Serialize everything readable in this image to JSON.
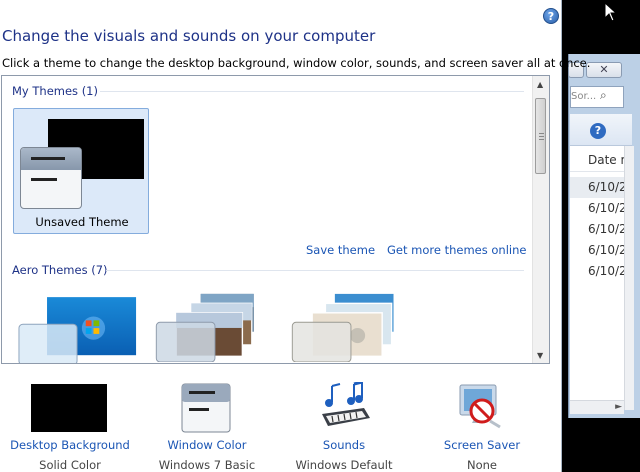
{
  "panel": {
    "title": "Change the visuals and sounds on your computer",
    "subtitle": "Click a theme to change the desktop background, window color, sounds, and screen saver all at once.",
    "help_icon": "help-icon"
  },
  "my_themes": {
    "heading": "My Themes (1)",
    "theme_label": "Unsaved Theme",
    "save_link": "Save theme",
    "more_link": "Get more themes online"
  },
  "aero_themes": {
    "heading": "Aero Themes (7)"
  },
  "bottom": {
    "desktop_background": {
      "label": "Desktop Background",
      "value": "Solid Color",
      "icon": "desktop-background-icon"
    },
    "window_color": {
      "label": "Window Color",
      "value": "Windows 7 Basic",
      "icon": "window-color-icon"
    },
    "sounds": {
      "label": "Sounds",
      "value": "Windows Default",
      "icon": "sounds-icon"
    },
    "screen_saver": {
      "label": "Screen Saver",
      "value": "None",
      "icon": "screen-saver-icon"
    }
  },
  "background_window": {
    "search_text": "Sor...",
    "column_header": "Date m",
    "rows": [
      "6/10/2",
      "6/10/2",
      "6/10/2",
      "6/10/2",
      "6/10/2"
    ],
    "close_glyph": "✕"
  },
  "colors": {
    "title": "#1e3287",
    "link": "#1a55b4",
    "selection": "#dce9f9"
  }
}
